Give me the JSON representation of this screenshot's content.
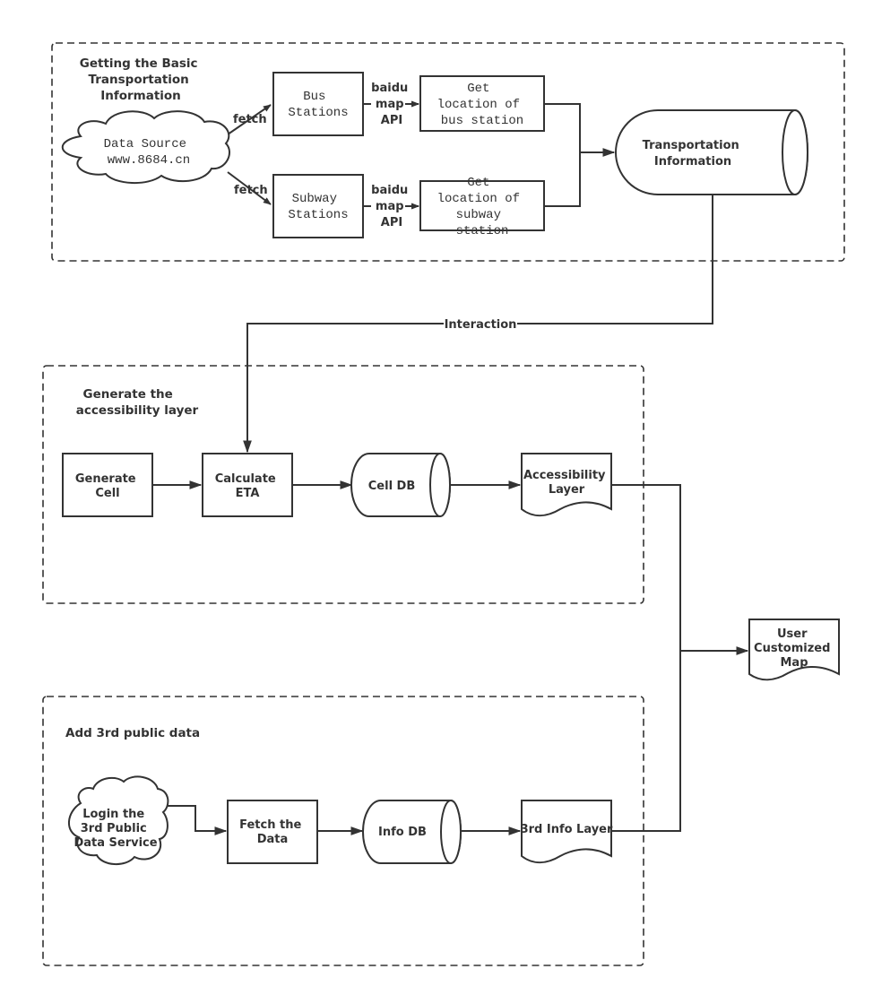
{
  "groups": {
    "basic_info": {
      "title_lines": [
        "Getting the Basic",
        "Transportation",
        "Information"
      ]
    },
    "accessibility": {
      "title_lines": [
        "Generate the",
        "accessibility layer"
      ]
    },
    "third_party": {
      "title_lines": [
        "Add 3rd public data"
      ]
    }
  },
  "nodes": {
    "data_source": {
      "lines": [
        "Data Source",
        "www.8684.cn"
      ]
    },
    "bus_stations": {
      "lines": [
        "Bus",
        "Stations"
      ]
    },
    "subway_stations": {
      "lines": [
        "Subway",
        "Stations"
      ]
    },
    "bus_location": {
      "lines": [
        "Get",
        "location of",
        "bus station"
      ]
    },
    "subway_location": {
      "lines": [
        "Get",
        "location of",
        "subway",
        "station"
      ]
    },
    "transport_info": {
      "lines": [
        "Transportation",
        "Information"
      ]
    },
    "generate_cell": {
      "lines": [
        "Generate",
        "Cell"
      ]
    },
    "calculate_eta": {
      "lines": [
        "Calculate",
        "ETA"
      ]
    },
    "cell_db": {
      "lines": [
        "Cell DB"
      ]
    },
    "accessibility_layer": {
      "lines": [
        "Accessibility",
        "Layer"
      ]
    },
    "user_map": {
      "lines": [
        "User",
        "Customized",
        "Map"
      ]
    },
    "login_service": {
      "lines": [
        "Login the",
        "3rd Public",
        "Data Service"
      ]
    },
    "fetch_data": {
      "lines": [
        "Fetch the",
        "Data"
      ]
    },
    "info_db": {
      "lines": [
        "Info DB"
      ]
    },
    "info_layer": {
      "lines": [
        "3rd Info Layer"
      ]
    }
  },
  "edge_labels": {
    "fetch_bus": "fetch",
    "fetch_subway": "fetch",
    "api_bus": [
      "baidu",
      "map",
      "API"
    ],
    "api_subway": [
      "baidu",
      "map",
      "API"
    ],
    "interaction": "Interaction"
  }
}
